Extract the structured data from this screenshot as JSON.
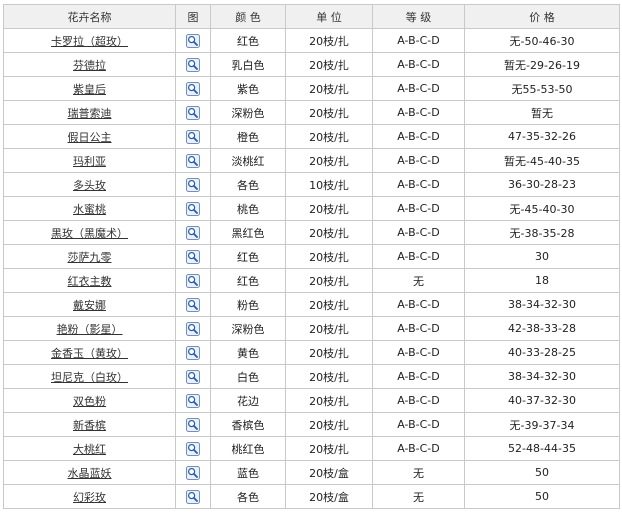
{
  "headers": {
    "name": "花卉名称",
    "image": "图",
    "color": "颜 色",
    "unit": "单 位",
    "grade": "等 级",
    "price": "价 格"
  },
  "icon": "magnifier-icon",
  "rows": [
    {
      "name": "卡罗拉（超玫）",
      "color": "红色",
      "unit": "20枝/扎",
      "grade": "A-B-C-D",
      "price": "无-50-46-30"
    },
    {
      "name": "芬德拉",
      "color": "乳白色",
      "unit": "20枝/扎",
      "grade": "A-B-C-D",
      "price": "暂无-29-26-19"
    },
    {
      "name": "紫皇后",
      "color": "紫色",
      "unit": "20枝/扎",
      "grade": "A-B-C-D",
      "price": "无55-53-50"
    },
    {
      "name": "瑞普索迪",
      "color": "深粉色",
      "unit": "20枝/扎",
      "grade": "A-B-C-D",
      "price": "暂无"
    },
    {
      "name": "假日公主",
      "color": "橙色",
      "unit": "20枝/扎",
      "grade": "A-B-C-D",
      "price": "47-35-32-26"
    },
    {
      "name": "玛利亚",
      "color": "淡桃红",
      "unit": "20枝/扎",
      "grade": "A-B-C-D",
      "price": "暂无-45-40-35"
    },
    {
      "name": "多头玫",
      "color": "各色",
      "unit": "10枝/扎",
      "grade": "A-B-C-D",
      "price": "36-30-28-23"
    },
    {
      "name": "水蜜桃",
      "color": "桃色",
      "unit": "20枝/扎",
      "grade": "A-B-C-D",
      "price": "无-45-40-30"
    },
    {
      "name": "黑玫（黑魔术）",
      "color": "黑红色",
      "unit": "20枝/扎",
      "grade": "A-B-C-D",
      "price": "无-38-35-28"
    },
    {
      "name": "莎萨九零",
      "color": "红色",
      "unit": "20枝/扎",
      "grade": "A-B-C-D",
      "price": "30"
    },
    {
      "name": "红衣主教",
      "color": "红色",
      "unit": "20枝/扎",
      "grade": "无",
      "price": "18"
    },
    {
      "name": "戴安娜",
      "color": "粉色",
      "unit": "20枝/扎",
      "grade": "A-B-C-D",
      "price": "38-34-32-30"
    },
    {
      "name": "艳粉（影星）",
      "color": "深粉色",
      "unit": "20枝/扎",
      "grade": "A-B-C-D",
      "price": "42-38-33-28"
    },
    {
      "name": "金香玉（黄玫）",
      "color": "黄色",
      "unit": "20枝/扎",
      "grade": "A-B-C-D",
      "price": "40-33-28-25"
    },
    {
      "name": "坦尼克（白玫）",
      "color": "白色",
      "unit": "20枝/扎",
      "grade": "A-B-C-D",
      "price": "38-34-32-30"
    },
    {
      "name": "双色粉",
      "color": "花边",
      "unit": "20枝/扎",
      "grade": "A-B-C-D",
      "price": "40-37-32-30"
    },
    {
      "name": "新香槟",
      "color": "香槟色",
      "unit": "20枝/扎",
      "grade": "A-B-C-D",
      "price": "无-39-37-34"
    },
    {
      "name": "大桃红",
      "color": "桃红色",
      "unit": "20枝/扎",
      "grade": "A-B-C-D",
      "price": "52-48-44-35"
    },
    {
      "name": "水晶蓝妖",
      "color": "蓝色",
      "unit": "20枝/盒",
      "grade": "无",
      "price": "50"
    },
    {
      "name": "幻彩玫",
      "color": "各色",
      "unit": "20枝/盒",
      "grade": "无",
      "price": "50"
    }
  ]
}
